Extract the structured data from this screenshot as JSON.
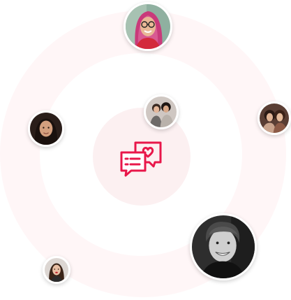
{
  "accent_color": "#e8174a",
  "center_icon": "chat-bubbles-heart-icon",
  "avatars": [
    {
      "name": "woman-glasses-pink-hair"
    },
    {
      "name": "two-women-selfie"
    },
    {
      "name": "woman-dark-hair"
    },
    {
      "name": "two-women-smiling"
    },
    {
      "name": "man-curly-hair-smiling"
    },
    {
      "name": "woman-red-lips"
    }
  ]
}
